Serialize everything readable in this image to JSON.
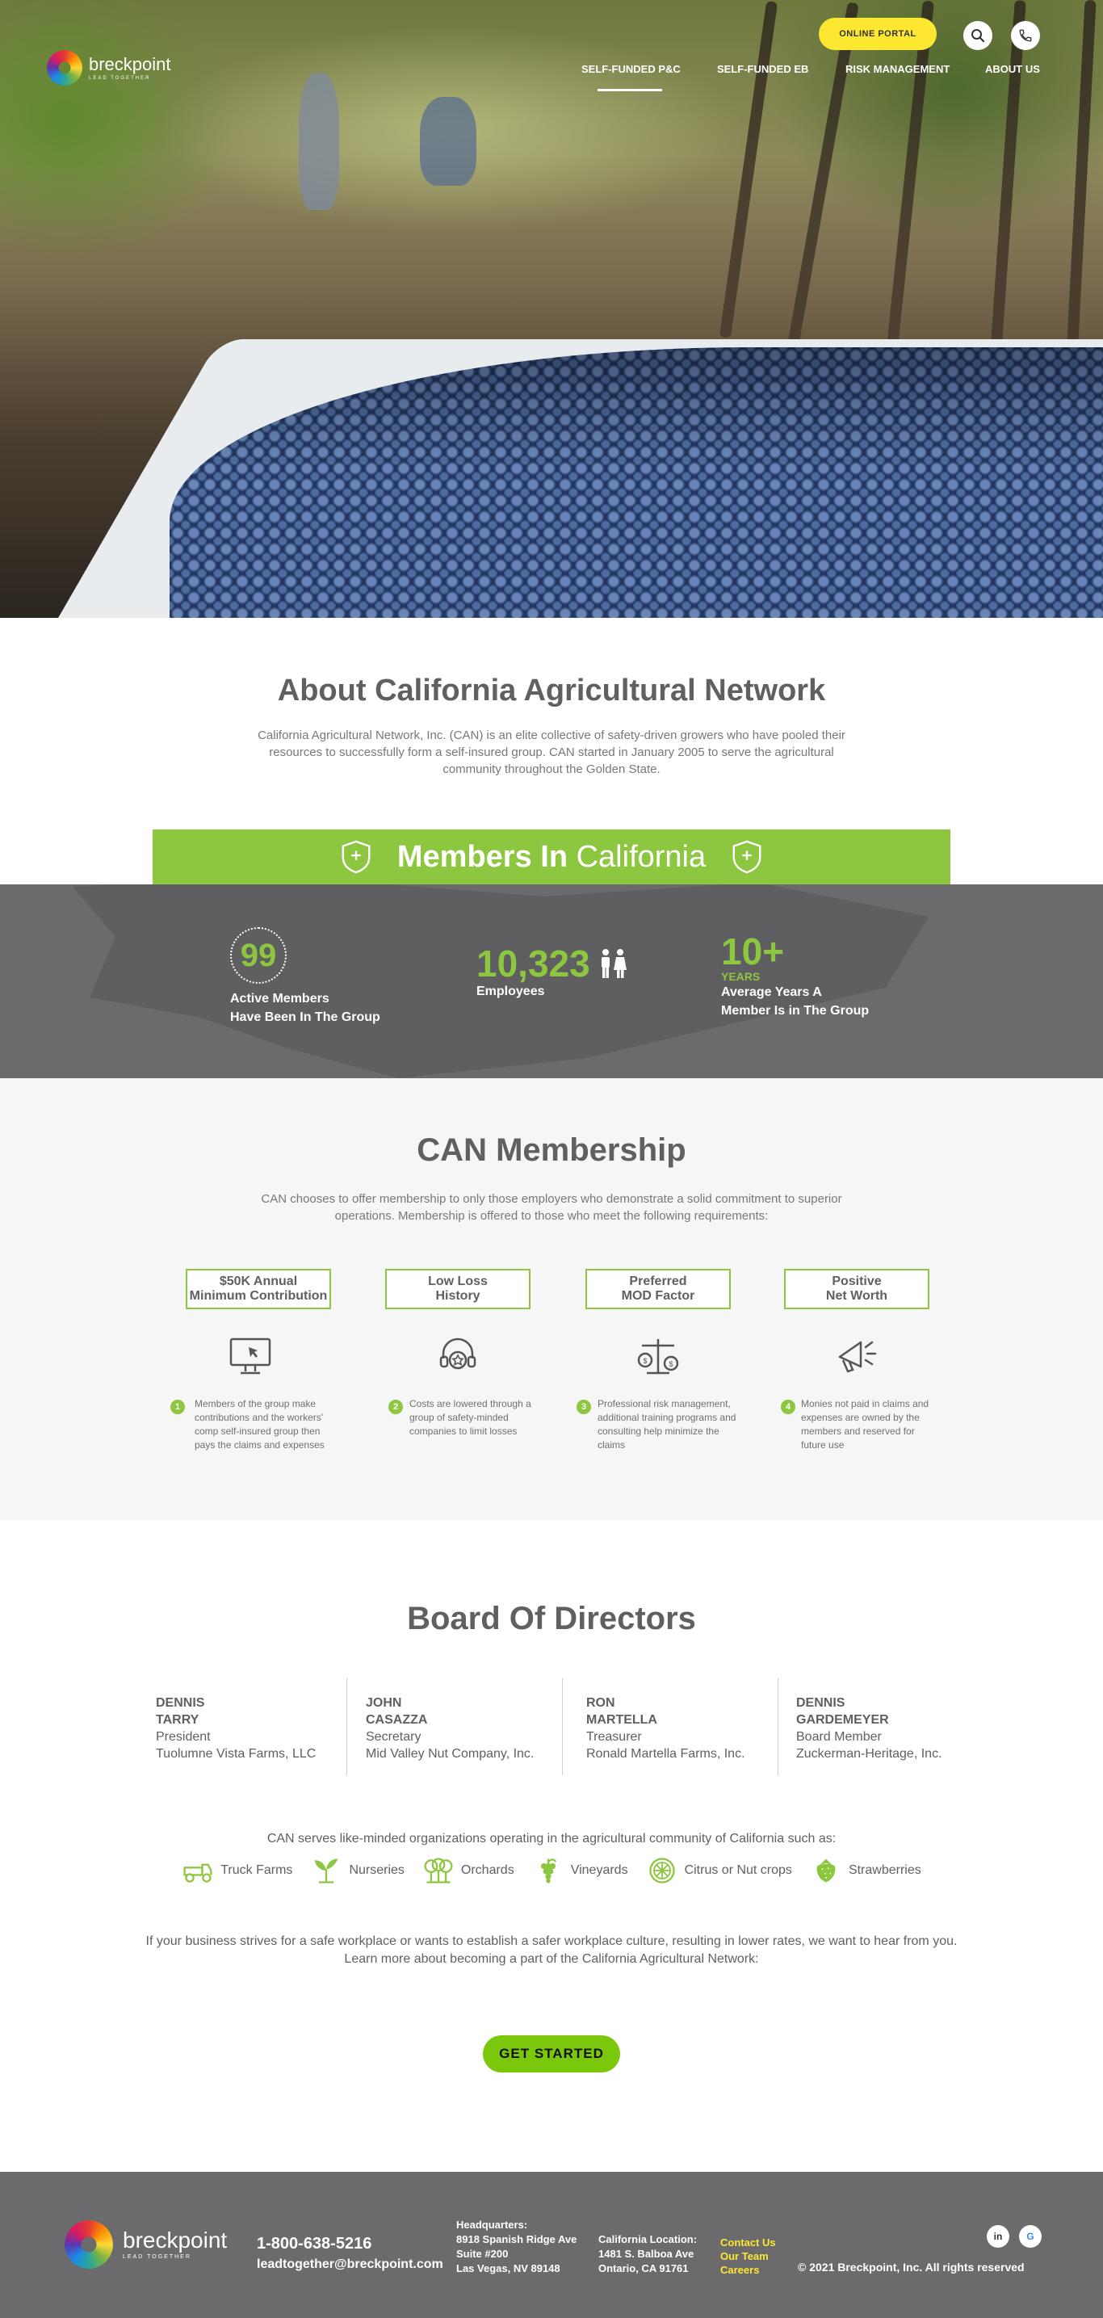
{
  "brand": {
    "name": "breckpoint",
    "tagline": "LEAD TOGETHER"
  },
  "header": {
    "portal_button": "ONLINE PORTAL",
    "search_icon": "search-icon",
    "phone_icon": "phone-icon",
    "nav": [
      {
        "label": "SELF-FUNDED P&C",
        "active": true
      },
      {
        "label": "SELF-FUNDED EB",
        "active": false
      },
      {
        "label": "RISK MANAGEMENT",
        "active": false
      },
      {
        "label": "ABOUT US",
        "active": false
      }
    ]
  },
  "about": {
    "title_bold": "About California",
    "title_light": " Agricultural Network",
    "text": "California Agricultural Network, Inc. (CAN) is an elite collective of safety-driven growers who have pooled their resources to successfully form a self-insured group. CAN started in January 2005 to serve the agricultural community throughout the Golden State."
  },
  "members": {
    "banner_bold": "Members In",
    "banner_light": " California",
    "stats": [
      {
        "value": "99",
        "label_line1": "Active Members",
        "label_line2": "Have Been In The Group"
      },
      {
        "value": "10,323",
        "label_line1": "Employees"
      },
      {
        "value": "10+",
        "unit": "YEARS",
        "label_line1": "Average Years  A",
        "label_line2": "Member Is in The Group"
      }
    ]
  },
  "membership": {
    "title_bold": "CAN",
    "title_light": " Membership",
    "text": "CAN  chooses to offer membership to only those employers who demonstrate a solid commitment to superior operations. Membership is offered to those who meet the following requirements:",
    "requirements": [
      {
        "title1": "$50K Annual",
        "title2": "Minimum Contribution",
        "num": "1",
        "icon": "monitor-cursor-icon",
        "desc": "Members of the group make contributions and the workers' comp self-insured group then pays the claims and expenses"
      },
      {
        "title1": "Low Loss",
        "title2": "History",
        "num": "2",
        "icon": "headset-star-icon",
        "desc": "Costs are lowered through a group of safety-minded companies to limit losses"
      },
      {
        "title1": "Preferred",
        "title2": "MOD Factor",
        "num": "3",
        "icon": "scales-icon",
        "desc": "Professional risk management, additional training programs and consulting help minimize the claims"
      },
      {
        "title1": "Positive",
        "title2": "Net Worth",
        "num": "4",
        "icon": "megaphone-icon",
        "desc": "Monies not paid in claims and expenses are owned by the members and reserved for future use"
      }
    ]
  },
  "board": {
    "title_bold": "Board",
    "title_light": " Of Directors",
    "directors": [
      {
        "first": "DENNIS",
        "last": "TARRY",
        "role": "President",
        "company": "Tuolumne Vista Farms, LLC"
      },
      {
        "first": "JOHN",
        "last": "CASAZZA",
        "role": "Secretary",
        "company": "Mid Valley Nut Company, Inc."
      },
      {
        "first": "RON",
        "last": "MARTELLA",
        "role": "Treasurer",
        "company": "Ronald Martella Farms, Inc."
      },
      {
        "first": "DENNIS",
        "last": "GARDEMEYER",
        "role": "Board Member",
        "company": "Zuckerman-Heritage, Inc."
      }
    ]
  },
  "serves": {
    "text": "CAN serves like-minded organizations operating in the agricultural community of California such as:",
    "industries": [
      {
        "label": "Truck Farms",
        "icon": "tractor-icon"
      },
      {
        "label": "Nurseries",
        "icon": "sprout-icon"
      },
      {
        "label": "Orchards",
        "icon": "trees-icon"
      },
      {
        "label": "Vineyards",
        "icon": "grapes-icon"
      },
      {
        "label": "Citrus or Nut crops",
        "icon": "citrus-icon"
      },
      {
        "label": "Strawberries",
        "icon": "strawberry-icon"
      }
    ]
  },
  "cta": {
    "line1": "If your business strives for a safe workplace or wants to establish a safer workplace culture, resulting in lower rates, we want to hear from you.",
    "line2": "Learn more about becoming a part of the California Agricultural Network:",
    "button": "GET STARTED"
  },
  "footer": {
    "phone": "1-800-638-5216",
    "email": "leadtogether@breckpoint.com",
    "hq": {
      "title": "Headquarters:",
      "line1": "8918 Spanish Ridge Ave",
      "line2": "Suite #200",
      "line3": "Las Vegas, NV 89148"
    },
    "ca": {
      "title": "California Location:",
      "line1": "1481 S. Balboa Ave",
      "line2": "Ontario, CA 91761"
    },
    "links": [
      "Contact Us",
      "Our Team",
      "Careers"
    ],
    "copyright": "© 2021 Breckpoint, Inc. All rights reserved",
    "social": [
      {
        "label": "in",
        "icon": "linkedin-icon"
      },
      {
        "label": "G",
        "icon": "google-icon"
      }
    ]
  },
  "colors": {
    "green": "#8dc63f",
    "yellow": "#fde730",
    "gray": "#6b6b6d",
    "text": "#5f6062"
  }
}
